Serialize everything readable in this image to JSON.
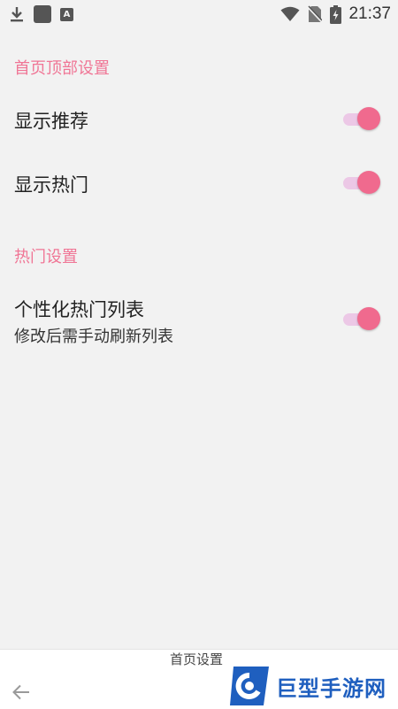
{
  "status_bar": {
    "left_icons": [
      "download-icon",
      "app-square-icon",
      "a-badge-icon"
    ],
    "right_icons": [
      "wifi-icon",
      "no-sim-icon",
      "battery-charging-icon"
    ],
    "time": "21:37",
    "a_badge": "A"
  },
  "sections": [
    {
      "header": "首页顶部设置",
      "items": [
        {
          "title": "显示推荐",
          "enabled": true
        },
        {
          "title": "显示热门",
          "enabled": true
        }
      ]
    },
    {
      "header": "热门设置",
      "items": [
        {
          "title": "个性化热门列表",
          "subtitle": "修改后需手动刷新列表",
          "enabled": true
        }
      ]
    }
  ],
  "bottom_bar": {
    "title": "首页设置",
    "back_icon": "arrow-left-icon"
  },
  "watermark": {
    "text": "巨型手游网"
  },
  "colors": {
    "accent": "#f07595",
    "toggle_thumb": "#f06a8e",
    "toggle_track": "#ecc8e6",
    "background": "#f2f2f2",
    "watermark_blue": "#1f5fbf"
  }
}
